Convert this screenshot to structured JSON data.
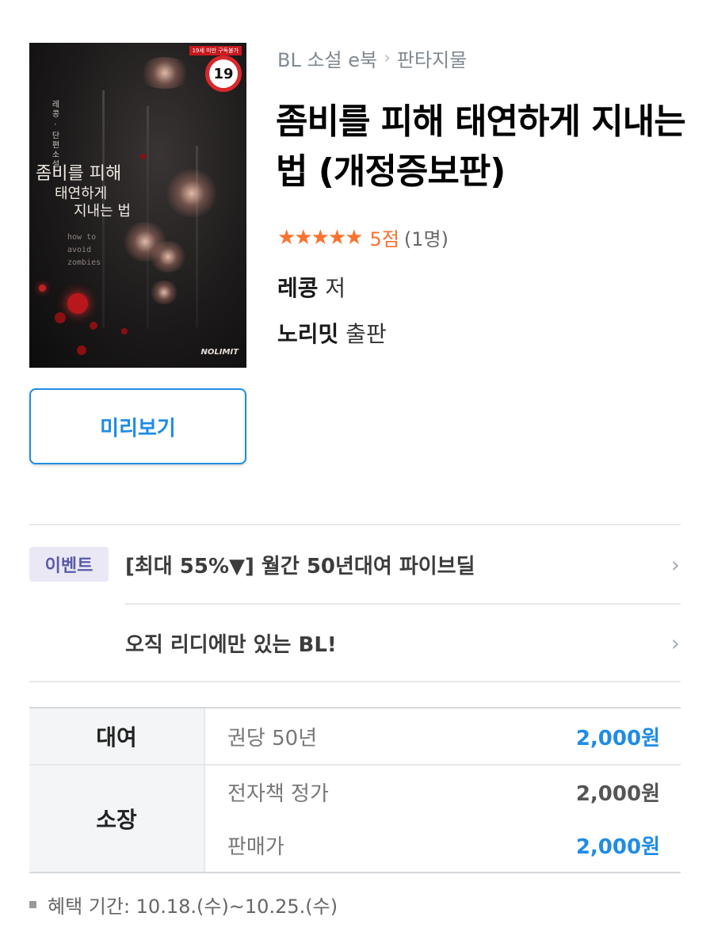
{
  "cover": {
    "age_notice": "19세 미만 구독불가",
    "age_badge": "19",
    "author_line": "레콩 · 단편소설",
    "title_line1": "좀비를 피해",
    "title_line2": "태연하게",
    "title_line3": "지내는 법",
    "english_title": [
      "how to",
      "avoid",
      "zombies"
    ],
    "publisher_logo": "NOLIMIT"
  },
  "breadcrumb": {
    "category": "BL 소설 e북",
    "subcategory": "판타지물"
  },
  "book": {
    "title": "좀비를 피해 태연하게 지내는 법 (개정증보판)",
    "stars": "★★★★★",
    "score": "5점",
    "rating_count": "(1명)",
    "author_name": "레콩",
    "author_suffix": " 저",
    "publisher_name": "노리밋",
    "publisher_suffix": " 출판"
  },
  "preview_label": "미리보기",
  "events": {
    "badge": "이벤트",
    "items": [
      "[최대 55%▼] 월간 50년대여 파이브딜",
      "오직 리디에만 있는 BL!"
    ]
  },
  "pricing": {
    "rent": {
      "label": "대여",
      "item": "권당 50년",
      "price": "2,000원"
    },
    "own": {
      "label": "소장",
      "list_label": "전자책 정가",
      "list_price": "2,000원",
      "sale_label": "판매가",
      "sale_price": "2,000원"
    }
  },
  "benefit_period": "혜택 기간: 10.18.(수)~10.25.(수)",
  "colors": {
    "accent": "#1f8ce6",
    "star": "#fa722e",
    "event_badge_bg": "#e9e8f4",
    "event_badge_text": "#5b5aa8"
  },
  "icons": [
    "chevron-right-icon",
    "star-icon"
  ]
}
